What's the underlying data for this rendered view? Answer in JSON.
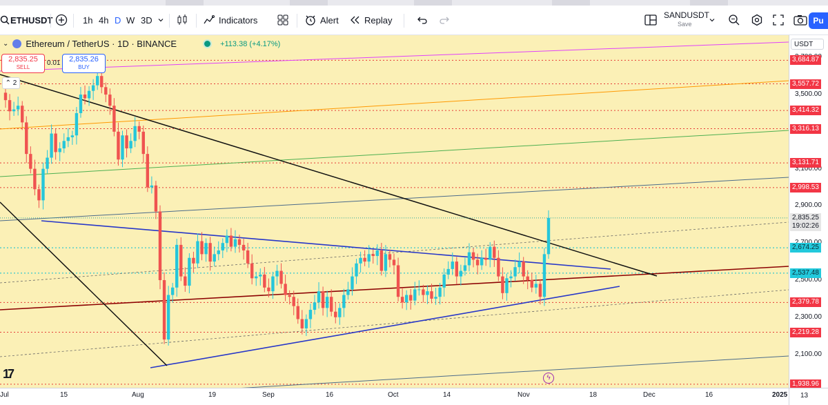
{
  "toolbar": {
    "symbol": "ETHUSDT",
    "intervals": [
      "1h",
      "4h",
      "D",
      "W",
      "3D"
    ],
    "active_interval": "D",
    "indicators_label": "Indicators",
    "alert_label": "Alert",
    "replay_label": "Replay",
    "layout_name": "SANDUSDT",
    "save_label": "Save",
    "publish_label": "Pu"
  },
  "legend": {
    "pair": "Ethereum / TetherUS · 1D · BINANCE",
    "change": "+113.38 (+4.17%)",
    "sell_price": "2,835.25",
    "sell_label": "SELL",
    "buy_price": "2,835.26",
    "buy_label": "BUY",
    "spread": "0.01",
    "collapse_count": "2"
  },
  "colors": {
    "background": "#fbf0b6",
    "up": "#26c6da",
    "down": "#ef5350",
    "red_label": "#f23645",
    "blue_line": "#2636c8",
    "accent": "#2962ff"
  },
  "price_axis": {
    "currency": "USDT",
    "ticks": [
      "3,700.00",
      "3,500.00",
      "3,100.00",
      "2,900.00",
      "2,700.00",
      "2,500.00",
      "2,300.00",
      "2,100.00"
    ],
    "level_labels": [
      "3,684.87",
      "3,557.72",
      "3,414.32",
      "3,316.13",
      "3,131.71",
      "2,998.53",
      "2,674.25",
      "2,537.48",
      "2,379.78",
      "2,219.28",
      "1,938.96"
    ],
    "current_price": "2,835.25",
    "countdown": "19:02:26"
  },
  "time_axis": {
    "labels": [
      "Jul",
      "15",
      "Aug",
      "19",
      "Sep",
      "16",
      "Oct",
      "14",
      "Nov",
      "18",
      "Dec",
      "16",
      "2025",
      "13"
    ]
  },
  "chart_data": {
    "type": "candlestick",
    "symbol": "ETHUSDT",
    "exchange": "BINANCE",
    "interval": "1D",
    "ylim": [
      1920,
      3820
    ],
    "y_ticks": [
      2100,
      2300,
      2500,
      2700,
      2900,
      3100,
      3500,
      3700
    ],
    "x_labels": [
      "Jul",
      "15",
      "Aug",
      "19",
      "Sep",
      "16",
      "Oct",
      "14",
      "Nov",
      "18",
      "Dec",
      "16",
      "2025",
      "13"
    ],
    "horizontal_levels": [
      3684.87,
      3557.72,
      3414.32,
      3316.13,
      3131.71,
      2998.53,
      2674.25,
      2537.48,
      2379.78,
      2219.28,
      1938.96
    ],
    "last_price": 2835.25,
    "close_series": [
      3470,
      3410,
      3420,
      3440,
      3350,
      3180,
      3100,
      2990,
      2930,
      3100,
      3160,
      3290,
      3190,
      3210,
      3250,
      3270,
      3280,
      3400,
      3500,
      3480,
      3520,
      3550,
      3600,
      3540,
      3500,
      3440,
      3300,
      3150,
      3280,
      3210,
      3250,
      3330,
      3300,
      3180,
      3000,
      3010,
      2870,
      2500,
      2180,
      2420,
      2460,
      2690,
      2520,
      2470,
      2620,
      2590,
      2710,
      2640,
      2700,
      2600,
      2640,
      2660,
      2700,
      2740,
      2680,
      2720,
      2690,
      2660,
      2590,
      2510,
      2520,
      2530,
      2460,
      2440,
      2520,
      2550,
      2480,
      2420,
      2410,
      2360,
      2290,
      2240,
      2290,
      2340,
      2380,
      2440,
      2350,
      2410,
      2330,
      2300,
      2350,
      2420,
      2450,
      2520,
      2590,
      2620,
      2600,
      2640,
      2630,
      2660,
      2550,
      2640,
      2610,
      2580,
      2410,
      2380,
      2420,
      2390,
      2450,
      2450,
      2420,
      2440,
      2400,
      2410,
      2460,
      2530,
      2560,
      2600,
      2520,
      2550,
      2580,
      2650,
      2610,
      2580,
      2620,
      2610,
      2680,
      2620,
      2520,
      2430,
      2510,
      2520,
      2570,
      2600,
      2520,
      2500,
      2460,
      2480,
      2410,
      2640,
      2835
    ]
  }
}
